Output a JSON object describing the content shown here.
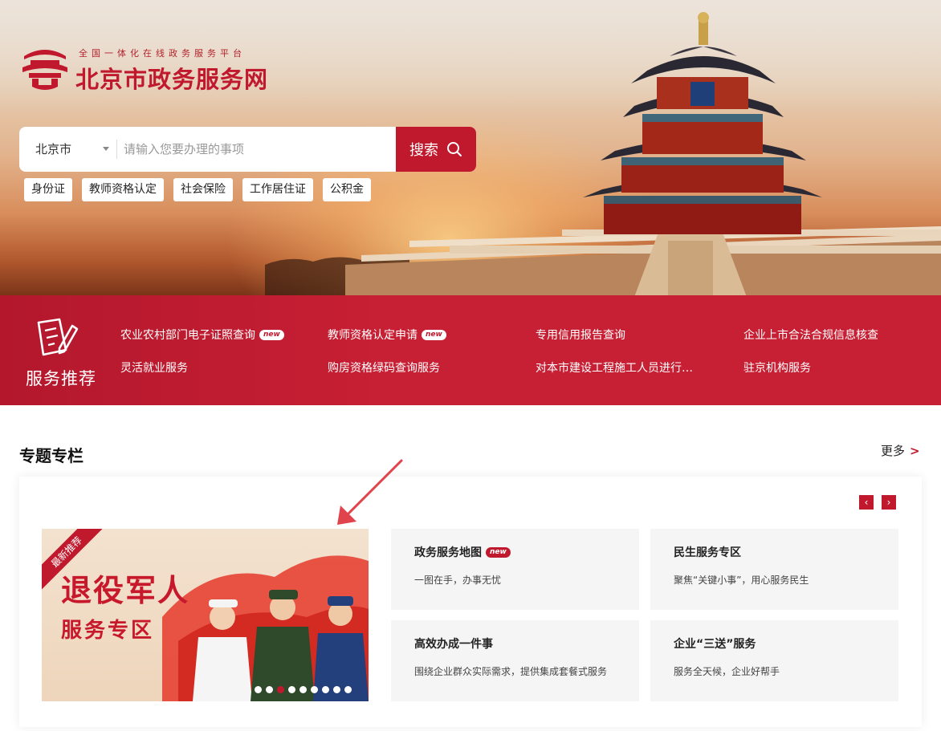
{
  "header": {
    "slogan": "全国一体化在线政务服务平台",
    "site_name": "北京市政务服务网"
  },
  "search": {
    "region": "北京市",
    "placeholder": "请输入您要办理的事项",
    "button_label": "搜索"
  },
  "hot_tags": [
    "身份证",
    "教师资格认定",
    "社会保险",
    "工作居住证",
    "公积金"
  ],
  "services": {
    "title": "服务推荐",
    "new_badge": "new",
    "items": [
      {
        "label": "农业农村部门电子证照查询",
        "new": true
      },
      {
        "label": "教师资格认定申请",
        "new": true
      },
      {
        "label": "专用信用报告查询",
        "new": false
      },
      {
        "label": "企业上市合法合规信息核查",
        "new": false
      },
      {
        "label": "灵活就业服务",
        "new": false
      },
      {
        "label": "购房资格绿码查询服务",
        "new": false
      },
      {
        "label": "对本市建设工程施工人员进行…",
        "new": false
      },
      {
        "label": "驻京机构服务",
        "new": false
      }
    ]
  },
  "topics": {
    "title": "专题专栏",
    "more_label": "更多",
    "more_arrow": ">",
    "prev_label": "‹",
    "next_label": "›",
    "banner": {
      "ribbon": "最新推荐",
      "title": "退役军人",
      "subtitle": "服务专区",
      "dot_count": 9,
      "active_dot": 2
    },
    "cards": [
      {
        "title": "政务服务地图",
        "new": true,
        "desc": "一图在手，办事无忧"
      },
      {
        "title": "民生服务专区",
        "new": false,
        "desc": "聚焦“关键小事”，用心服务民生"
      },
      {
        "title": "高效办成一件事",
        "new": false,
        "desc": "围绕企业群众实际需求，提供集成套餐式服务"
      },
      {
        "title": "企业“三送”服务",
        "new": false,
        "desc": "服务全天候，企业好帮手"
      }
    ]
  },
  "colors": {
    "brand_red": "#c0192e",
    "band_red": "#c71f34",
    "annotation": "#e0434b"
  }
}
